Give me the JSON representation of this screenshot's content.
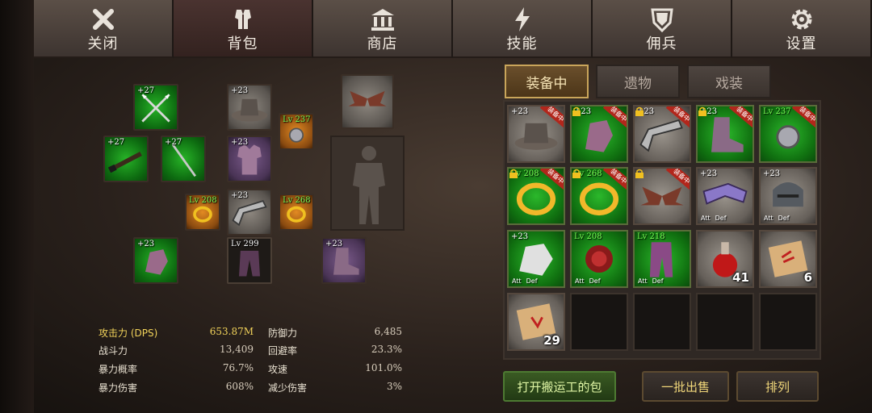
{
  "nav": {
    "tabs": [
      {
        "label": "关闭",
        "icon": "close-icon"
      },
      {
        "label": "背包",
        "icon": "armor-icon",
        "active": true
      },
      {
        "label": "商店",
        "icon": "shop-icon"
      },
      {
        "label": "技能",
        "icon": "lightning-icon"
      },
      {
        "label": "佣兵",
        "icon": "shield-icon"
      },
      {
        "label": "设置",
        "icon": "gear-icon"
      }
    ]
  },
  "equipment": {
    "slots": [
      {
        "name": "crossed-spears",
        "level": "+27"
      },
      {
        "name": "rifle",
        "level": "+27"
      },
      {
        "name": "staff-spear",
        "level": "+27"
      },
      {
        "name": "hat",
        "level": "+23"
      },
      {
        "name": "chest-armor",
        "level": "+23"
      },
      {
        "name": "shoulder-guard",
        "level": "+23"
      },
      {
        "name": "amulet",
        "level": "Lv 237"
      },
      {
        "name": "ring-left",
        "level": "Lv 208"
      },
      {
        "name": "ring-right",
        "level": "Lv 268"
      },
      {
        "name": "gauntlet",
        "level": "+23"
      },
      {
        "name": "leggings",
        "level": "Lv 299"
      },
      {
        "name": "boots",
        "level": "+23"
      },
      {
        "name": "wings",
        "level": ""
      }
    ]
  },
  "stats": [
    {
      "label": "攻击力 (DPS)",
      "value": "653.87M",
      "highlight": true
    },
    {
      "label": "战斗力",
      "value": "13,409"
    },
    {
      "label": "暴力概率",
      "value": "76.7%"
    },
    {
      "label": "暴力伤害",
      "value": "608%"
    },
    {
      "label": "防御力",
      "value": "6,485"
    },
    {
      "label": "回避率",
      "value": "23.3%"
    },
    {
      "label": "攻速",
      "value": "101.0%"
    },
    {
      "label": "减少伤害",
      "value": "3%"
    }
  ],
  "subtabs": [
    "装备中",
    "遗物",
    "戏装"
  ],
  "inventory": {
    "equipped_badge": "装备中",
    "att_label": "Att",
    "def_label": "Def",
    "items": [
      {
        "name": "hat",
        "level": "+23",
        "badge": true
      },
      {
        "name": "gauntlet",
        "level": "+23",
        "badge": true
      },
      {
        "name": "shoulder-guard",
        "level": "+23",
        "badge": true
      },
      {
        "name": "boots",
        "level": "+23",
        "badge": true
      },
      {
        "name": "amulet",
        "level": "Lv 237",
        "badge": true
      },
      {
        "name": "ring",
        "level": "Lv 208",
        "badge": true
      },
      {
        "name": "ring",
        "level": "Lv 268",
        "badge": true
      },
      {
        "name": "wings",
        "level": "",
        "badge": true
      },
      {
        "name": "purple-shoulder",
        "level": "+23"
      },
      {
        "name": "helmet",
        "level": "+23"
      },
      {
        "name": "white-gauntlet",
        "level": "+23"
      },
      {
        "name": "dark-chest",
        "level": "Lv 208"
      },
      {
        "name": "purple-leggings",
        "level": "Lv 218"
      },
      {
        "name": "red-potion",
        "count": "41"
      },
      {
        "name": "scroll",
        "count": "6"
      },
      {
        "name": "scroll-2",
        "count": "29"
      }
    ]
  },
  "buttons": {
    "open_porter": "打开搬运工的包",
    "batch_sell": "一批出售",
    "sort": "排列"
  },
  "colors": {
    "accent_gold": "#f1d25a",
    "level_green": "#7cff58",
    "badge_red": "#b2261b"
  }
}
